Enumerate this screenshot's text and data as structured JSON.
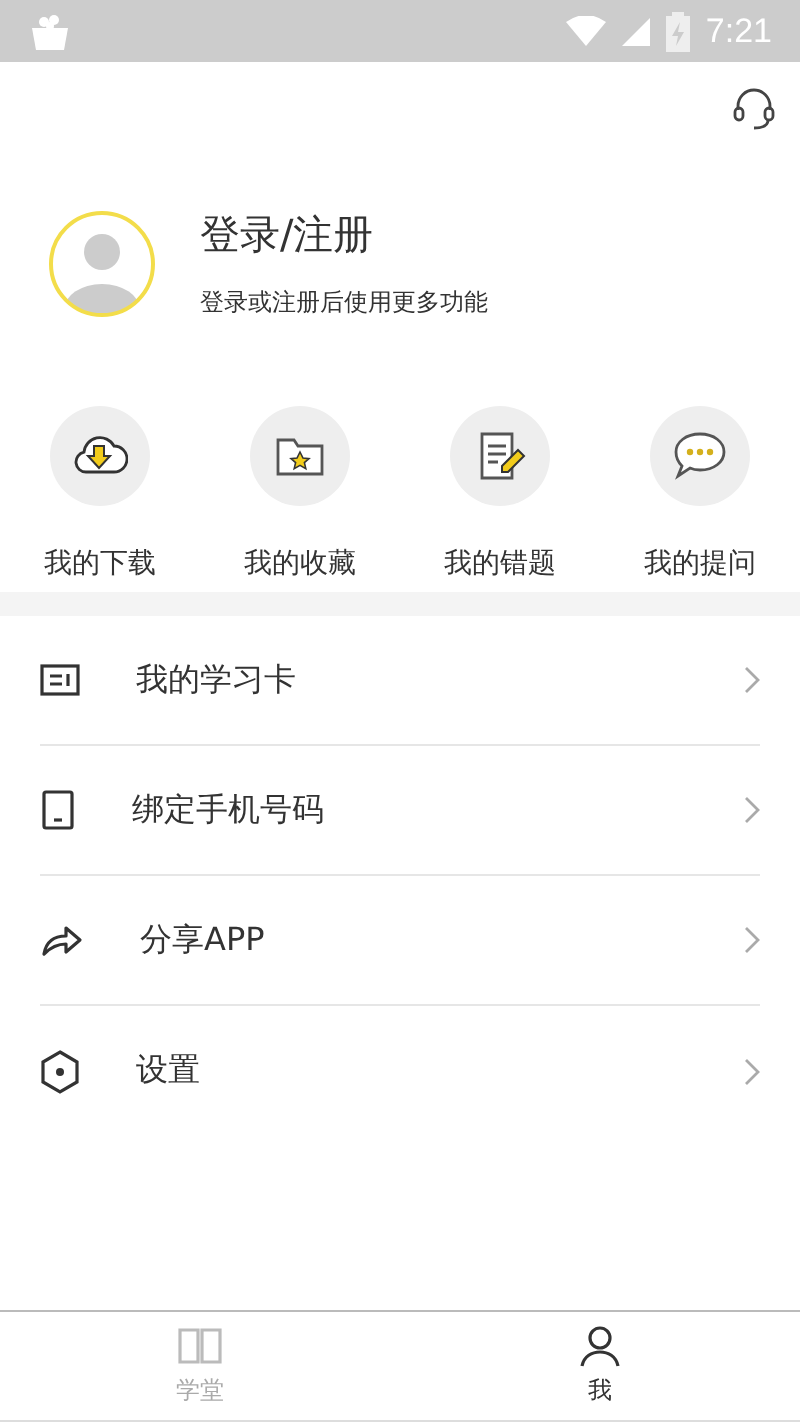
{
  "status_bar": {
    "time": "7:21"
  },
  "profile": {
    "title": "登录/注册",
    "subtitle": "登录或注册后使用更多功能"
  },
  "shortcuts": [
    {
      "kind": "download",
      "label": "我的下载"
    },
    {
      "kind": "favorite",
      "label": "我的收藏"
    },
    {
      "kind": "mistakes",
      "label": "我的错题"
    },
    {
      "kind": "questions",
      "label": "我的提问"
    }
  ],
  "menu": [
    {
      "kind": "card",
      "label": "我的学习卡"
    },
    {
      "kind": "phone",
      "label": "绑定手机号码"
    },
    {
      "kind": "share",
      "label": "分享APP"
    },
    {
      "kind": "settings",
      "label": "设置"
    }
  ],
  "tab_bar": [
    {
      "kind": "school",
      "label": "学堂",
      "selected": false
    },
    {
      "kind": "me",
      "label": "我",
      "selected": true
    }
  ]
}
